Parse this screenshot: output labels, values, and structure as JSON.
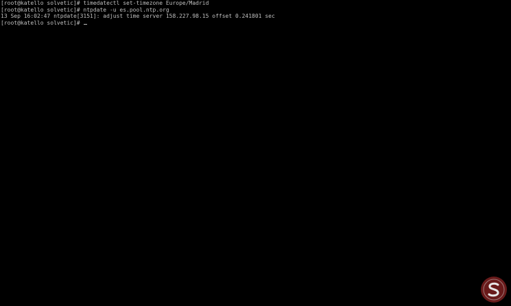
{
  "terminal": {
    "lines": [
      "[root@katello solvetic]# timedatectl set-timezone Europe/Madrid",
      "[root@katello solvetic]# ntpdate -u es.pool.ntp.org",
      "13 Sep 16:02:47 ntpdate[3151]: adjust time server 158.227.98.15 offset 0.241801 sec",
      "[root@katello solvetic]# "
    ]
  },
  "colors": {
    "background": "#000000",
    "text": "#c0c0c0",
    "watermark_circle": "#7a1e1e"
  },
  "watermark": {
    "icon": "solvetic-logo-icon"
  }
}
